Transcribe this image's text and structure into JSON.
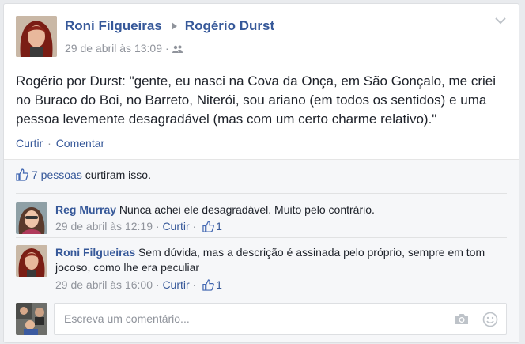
{
  "post": {
    "author": "Roni Filgueiras",
    "target": "Rogério Durst",
    "timestamp": "29 de abril às 13:09",
    "dot": "·",
    "audience_icon": "friends-icon",
    "text": "Rogério por Durst: \"gente, eu nasci na Cova da Onça, em São Gonçalo, me criei no Buraco do Boi, no Barreto, Niterói, sou ariano (em todos os sentidos) e uma pessoa levemente desagradável (mas com um certo charme relativo).\"",
    "like_label": "Curtir",
    "comment_label": "Comentar",
    "actions_sep": "·"
  },
  "likes": {
    "count_text": "7 pessoas",
    "suffix": "curtiram isso."
  },
  "comments": [
    {
      "name": "Reg Murray",
      "text": "Nunca achei ele desagradável. Muito pelo contrário.",
      "time": "29 de abril às 12:19",
      "like_label": "Curtir",
      "likes": "1"
    },
    {
      "name": "Roni Filgueiras",
      "text": "Sem dúvida, mas a descrição é assinada pelo próprio, sempre em tom jocoso, como lhe era peculiar",
      "time": "29 de abril às 16:00",
      "like_label": "Curtir",
      "likes": "1"
    }
  ],
  "reply": {
    "placeholder": "Escreva um comentário..."
  },
  "colors": {
    "link": "#365899",
    "meta": "#90949c",
    "text": "#1d2129",
    "ufi_bg": "#f6f7f9"
  }
}
